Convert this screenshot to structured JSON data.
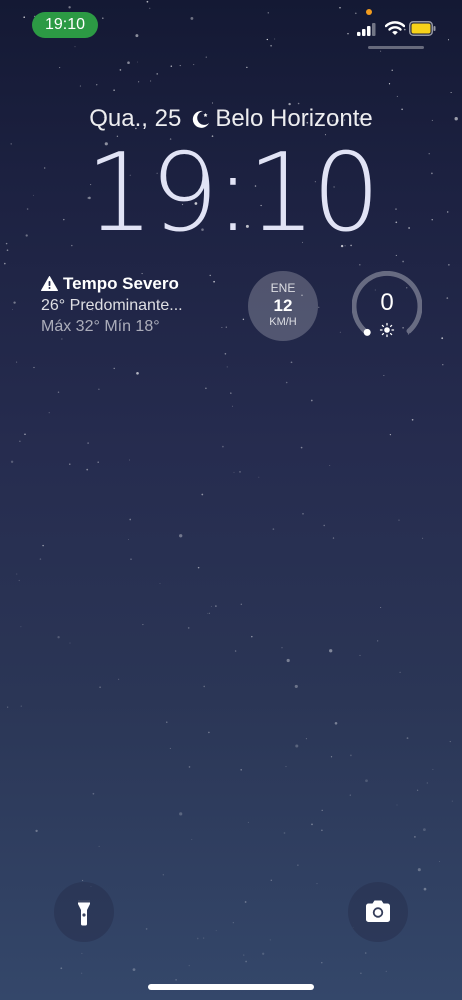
{
  "status_bar": {
    "time": "19:10",
    "time_pill_color": "#2c9a44",
    "privacy_dot_color": "#f29c1f",
    "battery_color": "#f7d21a",
    "icons": [
      "signal-icon",
      "wifi-icon",
      "battery-icon"
    ]
  },
  "lock_screen": {
    "date": "Qua., 25",
    "location": "Belo Horizonte",
    "clock": "19:10"
  },
  "weather_widget": {
    "title": "Tempo Severo",
    "condition": "26° Predominante...",
    "range": "Máx 32° Mín 18°",
    "icon": "warning-icon"
  },
  "wind_widget": {
    "direction": "ENE",
    "speed": "12",
    "unit": "KM/H"
  },
  "uv_widget": {
    "value": "0",
    "level": 0,
    "icon": "sun-icon"
  },
  "bottom_controls": {
    "flashlight_icon": "flashlight-icon",
    "camera_icon": "camera-icon"
  }
}
